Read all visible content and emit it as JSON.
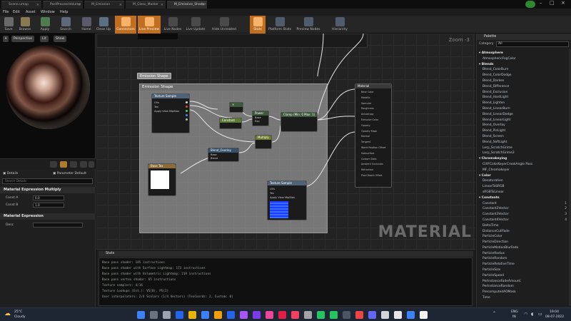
{
  "editor_tabs": [
    "Scene.umap",
    "PostProcessVolume",
    "M_Emission",
    "M_Glass_Master",
    "M_Emissive_Shader"
  ],
  "menu": [
    "File",
    "Edit",
    "Asset",
    "Window",
    "Help"
  ],
  "toolbar": [
    {
      "label": "Save",
      "highlight": false
    },
    {
      "label": "Browse",
      "highlight": false
    },
    {
      "label": "Apply",
      "highlight": false
    },
    {
      "label": "Search",
      "highlight": false
    },
    {
      "label": "Home",
      "highlight": false
    },
    {
      "label": "Clean Up",
      "highlight": false
    },
    {
      "label": "Connectors",
      "highlight": true
    },
    {
      "label": "Live Preview",
      "highlight": true
    },
    {
      "label": "Live Nodes",
      "highlight": false
    },
    {
      "label": "Live Update",
      "highlight": false
    },
    {
      "label": "Hide Unrelated",
      "highlight": false
    },
    {
      "label": "Stats",
      "highlight": true
    },
    {
      "label": "Platform Stats",
      "highlight": false
    },
    {
      "label": "Preview Nodes",
      "highlight": false
    },
    {
      "label": "Hierarchy",
      "highlight": false
    }
  ],
  "viewport": {
    "perspective": "Perspective",
    "lit": "Lit",
    "show": "Show"
  },
  "details": {
    "tab_details": "Details",
    "tab_params": "Parameter Default",
    "search_placeholder": "Search Details",
    "section1": "Material Expression Multiply",
    "const_a_label": "Const A",
    "const_a_value": "0.0",
    "const_b_label": "Const B",
    "const_b_value": "1.0",
    "section2": "Material Expression",
    "desc_label": "Desc"
  },
  "graph": {
    "zoom": "Zoom -3",
    "watermark": "MATERIAL",
    "comment_title": "Emission Shape",
    "comment_bubble": "Emission Shape",
    "nodes": {
      "tex1": {
        "title": "Texture Sample",
        "inputs": [
          "UVs",
          "Tex",
          "Apply View MipBias"
        ]
      },
      "mult1": {
        "title": "×"
      },
      "constant": {
        "title": "Constant"
      },
      "power": {
        "title": "Power",
        "pins": [
          "Base",
          "Exp"
        ]
      },
      "clamp": {
        "title": "Clamp (Min: 0 Max: 1)"
      },
      "multiply2": {
        "title": "Multiply"
      },
      "blend": {
        "title": "Blend_Overlay",
        "pins": [
          "Base",
          "Blend"
        ]
      },
      "basetex": {
        "title": "Base Tex"
      },
      "tex2": {
        "title": "Texture Sample",
        "inputs": [
          "UVs",
          "Tex",
          "Apply View MipBias"
        ]
      },
      "result": {
        "title": "Material",
        "pins": [
          "Base Color",
          "Metallic",
          "Specular",
          "Roughness",
          "Anisotropy",
          "Emissive Color",
          "Opacity",
          "Opacity Mask",
          "Normal",
          "Tangent",
          "World Position Offset",
          "Subsurface",
          "Custom Data",
          "Ambient Occlusion",
          "Refraction",
          "Pixel Depth Offset"
        ]
      }
    }
  },
  "stats": {
    "title": "Stats",
    "lines": [
      "Base pass shader: 145 instructions",
      "Base pass shader with Surface Lightmap: 173 instructions",
      "Base pass shader with Volumetric Lightmap: 219 instructions",
      "Base pass vertex shader: 65 instructions",
      "Texture samplers: 4/16",
      "Texture Lookups (Est.): VS(0), PS(2)",
      "User interpolators: 2/4 Scalars (1/4 Vectors) (TexCoords: 2, Custom: 0)"
    ]
  },
  "palette": {
    "title": "Palette",
    "category_label": "Category",
    "category_value": "All",
    "items": [
      {
        "text": "Atmosphere",
        "cat": true
      },
      {
        "text": "AtmosphericFogColor",
        "cat": false
      },
      {
        "text": "Blends",
        "cat": true
      },
      {
        "text": "Blend_ColorBurn",
        "cat": false
      },
      {
        "text": "Blend_ColorDodge",
        "cat": false
      },
      {
        "text": "Blend_Darken",
        "cat": false
      },
      {
        "text": "Blend_Difference",
        "cat": false
      },
      {
        "text": "Blend_Exclusion",
        "cat": false
      },
      {
        "text": "Blend_HardLight",
        "cat": false
      },
      {
        "text": "Blend_Lighten",
        "cat": false
      },
      {
        "text": "Blend_LinearBurn",
        "cat": false
      },
      {
        "text": "Blend_LinearDodge",
        "cat": false
      },
      {
        "text": "Blend_LinearLight",
        "cat": false
      },
      {
        "text": "Blend_Overlay",
        "cat": false
      },
      {
        "text": "Blend_PinLight",
        "cat": false
      },
      {
        "text": "Blend_Screen",
        "cat": false
      },
      {
        "text": "Blend_SoftLight",
        "cat": false
      },
      {
        "text": "Lerp_ScratchGrime",
        "cat": false
      },
      {
        "text": "Lerp_ScratchGrime2",
        "cat": false
      },
      {
        "text": "Chromakeying",
        "cat": true
      },
      {
        "text": "CIXFColorKeyerCrookAngle Pass",
        "cat": false
      },
      {
        "text": "MF_Chromakeyer",
        "cat": false
      },
      {
        "text": "Color",
        "cat": true
      },
      {
        "text": "Desaturation",
        "cat": false
      },
      {
        "text": "LinearToSRGB",
        "cat": false
      },
      {
        "text": "sRGBToLinear",
        "cat": false
      },
      {
        "text": "Constants",
        "cat": true
      },
      {
        "text": "Constant",
        "cat": false,
        "count": "1"
      },
      {
        "text": "Constant2Vector",
        "cat": false,
        "count": "2"
      },
      {
        "text": "Constant3Vector",
        "cat": false,
        "count": "3"
      },
      {
        "text": "Constant4Vector",
        "cat": false,
        "count": "4"
      },
      {
        "text": "DeltaTime",
        "cat": false
      },
      {
        "text": "DistanceCullFade",
        "cat": false
      },
      {
        "text": "ParticleColor",
        "cat": false
      },
      {
        "text": "ParticleDirection",
        "cat": false
      },
      {
        "text": "ParticleMotionBlurFade",
        "cat": false
      },
      {
        "text": "ParticleRadius",
        "cat": false
      },
      {
        "text": "ParticleRandom",
        "cat": false
      },
      {
        "text": "ParticleRelativeTime",
        "cat": false
      },
      {
        "text": "ParticleSize",
        "cat": false
      },
      {
        "text": "ParticleSpeed",
        "cat": false
      },
      {
        "text": "PerInstanceFadeAmount",
        "cat": false
      },
      {
        "text": "PerInstanceRandom",
        "cat": false
      },
      {
        "text": "PrecomputedAOMask",
        "cat": false
      },
      {
        "text": "Time",
        "cat": false
      }
    ]
  },
  "taskbar": {
    "temp": "25°C",
    "weather": "Cloudy",
    "lang": "ENG",
    "region": "IN",
    "time": "19:04",
    "date": "08-07-2022"
  }
}
